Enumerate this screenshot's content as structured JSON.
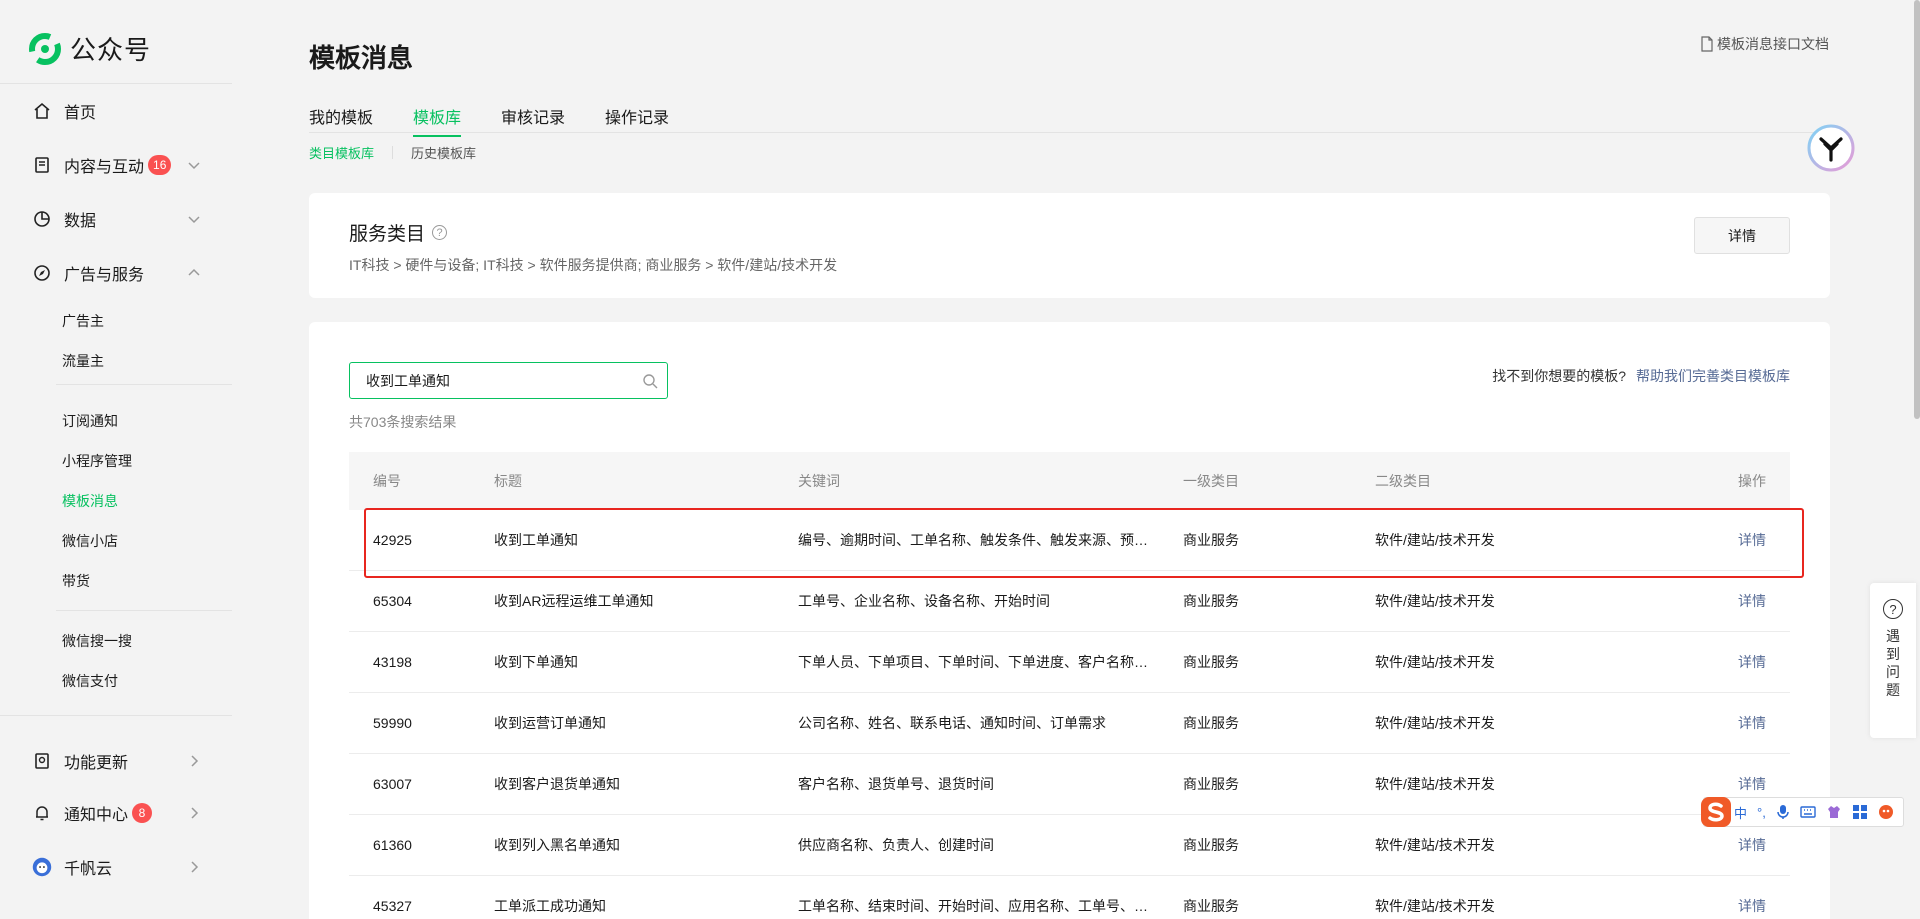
{
  "app": {
    "name": "公众号"
  },
  "sidebar": {
    "items": [
      {
        "label": "首页"
      },
      {
        "label": "内容与互动",
        "badge": "16"
      },
      {
        "label": "数据"
      },
      {
        "label": "广告与服务"
      },
      {
        "label": "功能更新"
      },
      {
        "label": "通知中心",
        "badge": "8"
      },
      {
        "label": "千帆云"
      }
    ],
    "sub_items": [
      {
        "label": "广告主"
      },
      {
        "label": "流量主"
      },
      {
        "label": "订阅通知"
      },
      {
        "label": "小程序管理"
      },
      {
        "label": "模板消息"
      },
      {
        "label": "微信小店"
      },
      {
        "label": "带货"
      },
      {
        "label": "微信搜一搜"
      },
      {
        "label": "微信支付"
      }
    ]
  },
  "header": {
    "title": "模板消息",
    "doc_link": "模板消息接口文档"
  },
  "tabs": [
    {
      "label": "我的模板"
    },
    {
      "label": "模板库"
    },
    {
      "label": "审核记录"
    },
    {
      "label": "操作记录"
    }
  ],
  "subtabs": [
    {
      "label": "类目模板库"
    },
    {
      "label": "历史模板库"
    }
  ],
  "category_card": {
    "title": "服务类目",
    "help_glyph": "?",
    "path": "IT科技 > 硬件与设备; IT科技 > 软件服务提供商; 商业服务 > 软件/建站/技术开发",
    "detail_button": "详情"
  },
  "search": {
    "value": "收到工单通知",
    "result_count": "共703条搜索结果",
    "help_question": "找不到你想要的模板?",
    "help_link": "帮助我们完善类目模板库"
  },
  "table": {
    "headers": [
      "编号",
      "标题",
      "关键词",
      "一级类目",
      "二级类目",
      "操作"
    ],
    "rows": [
      [
        "42925",
        "收到工单通知",
        "编号、逾期时间、工单名称、触发条件、触发来源、预…",
        "商业服务",
        "软件/建站/技术开发",
        "详情"
      ],
      [
        "65304",
        "收到AR远程运维工单通知",
        "工单号、企业名称、设备名称、开始时间",
        "商业服务",
        "软件/建站/技术开发",
        "详情"
      ],
      [
        "43198",
        "收到下单通知",
        "下单人员、下单项目、下单时间、下单进度、客户名称…",
        "商业服务",
        "软件/建站/技术开发",
        "详情"
      ],
      [
        "59990",
        "收到运营订单通知",
        "公司名称、姓名、联系电话、通知时间、订单需求",
        "商业服务",
        "软件/建站/技术开发",
        "详情"
      ],
      [
        "63007",
        "收到客户退货单通知",
        "客户名称、退货单号、退货时间",
        "商业服务",
        "软件/建站/技术开发",
        "详情"
      ],
      [
        "61360",
        "收到列入黑名单通知",
        "供应商名称、负责人、创建时间",
        "商业服务",
        "软件/建站/技术开发",
        "详情"
      ],
      [
        "45327",
        "工单派工成功通知",
        "工单名称、结束时间、开始时间、应用名称、工单号、…",
        "商业服务",
        "软件/建站/技术开发",
        "详情"
      ]
    ]
  },
  "float_help": {
    "glyph": "?",
    "label": "遇到问题"
  },
  "ime": {
    "items": [
      "中",
      "°,"
    ]
  },
  "colors": {
    "accent": "#07c160",
    "link": "#576b95",
    "badge": "#fa5151",
    "highlight": "#e8261f"
  }
}
